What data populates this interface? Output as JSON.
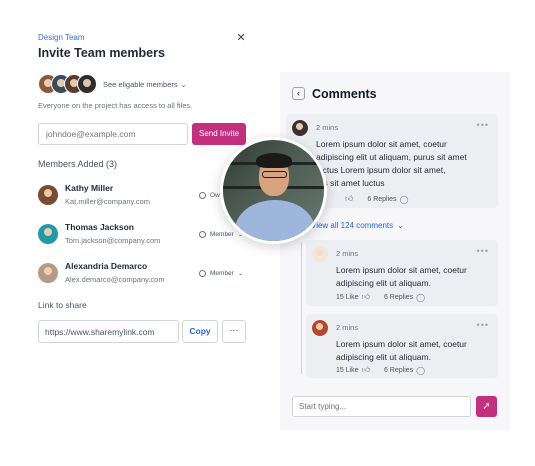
{
  "colors": {
    "accent": "#c2307f",
    "link": "#2563eb",
    "panel_bg": "#f7f7f9",
    "card_bg": "#eceef2"
  },
  "invite": {
    "team_label": "Design Team",
    "title": "Invite Team members",
    "close_icon": "close-icon",
    "eligible_label": "See eligable members",
    "access_note": "Everyone on the project has access to all files.",
    "email_placeholder": "johndoe@example.com",
    "send_label": "Send Invite",
    "members_heading": "Members Added (3)",
    "members": [
      {
        "name": "Kathy Miller",
        "email": "Kat.miller@company.com",
        "role": "Ow"
      },
      {
        "name": "Thomas Jackson",
        "email": "Tom.jackson@company.com",
        "role": "Member"
      },
      {
        "name": "Alexandria Demarco",
        "email": "Alex.demarco@company.com",
        "role": "Member"
      }
    ],
    "link_heading": "Link to share",
    "link_value": "https://www.sharemylink.com",
    "copy_label": "Copy",
    "more_label": "···"
  },
  "comments": {
    "title": "Comments",
    "back_icon": "chevron-left-icon",
    "items": [
      {
        "time": "2 mins",
        "text": [
          "Lorem ipsum dolor sit amet, coetur",
          "adipiscing elit ut aliquam, purus sit amet",
          "luctus Lorem ipsum dolor sit amet,",
          "rus sit amet luctus"
        ],
        "likes": "",
        "replies": "6 Replies"
      },
      {
        "time": "2 mins",
        "text": [
          "Lorem ipsum dolor sit amet, coetur",
          "adipiscing elit ut aliquam."
        ],
        "likes": "15 Like",
        "replies": "6 Replies"
      },
      {
        "time": "2 mins",
        "text": [
          "Lorem ipsum dolor sit amet, coetur",
          "adipiscing elit ut aliquam."
        ],
        "likes": "15 Like",
        "replies": "6 Replies"
      }
    ],
    "view_all": "View all 124 comments",
    "input_placeholder": "Start typing...",
    "send_icon": "rocket-send-icon"
  }
}
